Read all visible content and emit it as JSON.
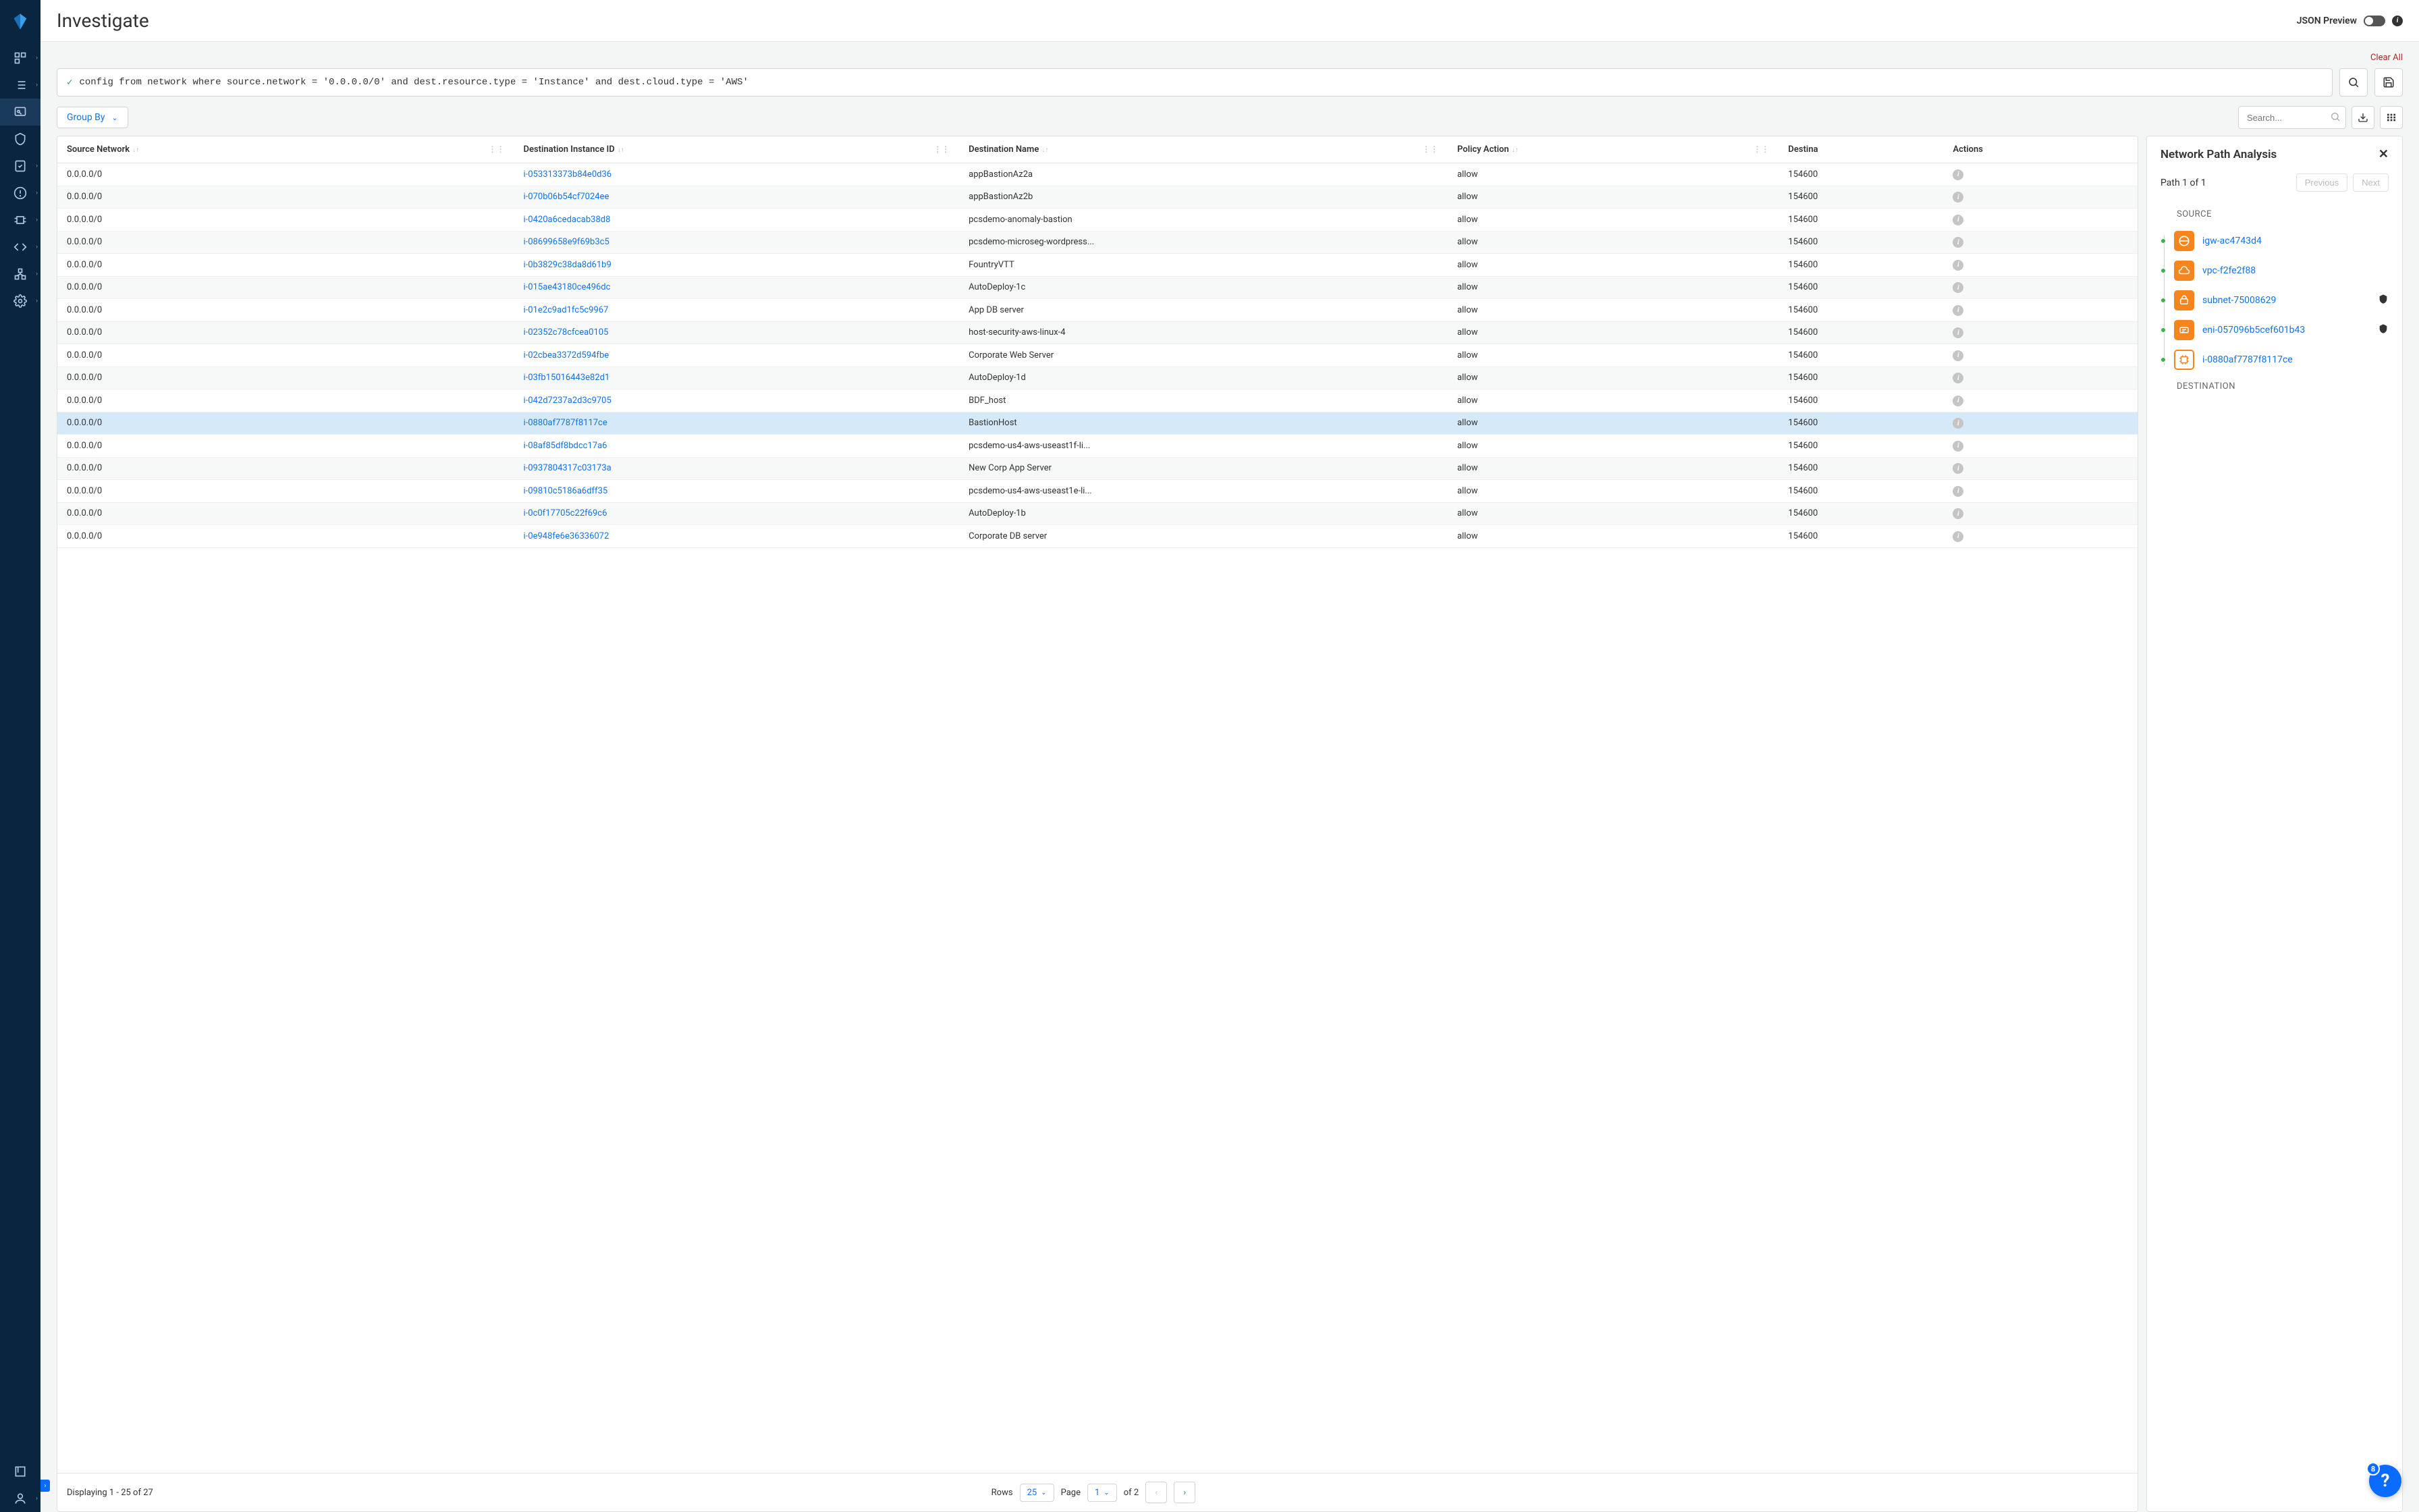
{
  "header": {
    "title": "Investigate",
    "json_preview_label": "JSON Preview"
  },
  "actions": {
    "clear_all": "Clear All"
  },
  "query": {
    "text": "config from network where source.network = '0.0.0.0/0' and dest.resource.type = 'Instance' and dest.cloud.type = 'AWS'"
  },
  "toolbar": {
    "group_by": "Group By",
    "search_placeholder": "Search..."
  },
  "table": {
    "columns": {
      "source_network": "Source Network",
      "dest_instance_id": "Destination Instance ID",
      "dest_name": "Destination Name",
      "policy_action": "Policy Action",
      "dest_trunc": "Destina",
      "actions": "Actions"
    },
    "rows": [
      {
        "src": "0.0.0.0/0",
        "inst": "i-053313373b84e0d36",
        "name": "appBastionAz2a",
        "policy": "allow",
        "dest": "154600"
      },
      {
        "src": "0.0.0.0/0",
        "inst": "i-070b06b54cf7024ee",
        "name": "appBastionAz2b",
        "policy": "allow",
        "dest": "154600"
      },
      {
        "src": "0.0.0.0/0",
        "inst": "i-0420a6cedacab38d8",
        "name": "pcsdemo-anomaly-bastion",
        "policy": "allow",
        "dest": "154600"
      },
      {
        "src": "0.0.0.0/0",
        "inst": "i-08699658e9f69b3c5",
        "name": "pcsdemo-microseg-wordpress...",
        "policy": "allow",
        "dest": "154600"
      },
      {
        "src": "0.0.0.0/0",
        "inst": "i-0b3829c38da8d61b9",
        "name": "FountryVTT",
        "policy": "allow",
        "dest": "154600"
      },
      {
        "src": "0.0.0.0/0",
        "inst": "i-015ae43180ce496dc",
        "name": "AutoDeploy-1c",
        "policy": "allow",
        "dest": "154600"
      },
      {
        "src": "0.0.0.0/0",
        "inst": "i-01e2c9ad1fc5c9967",
        "name": "App DB server",
        "policy": "allow",
        "dest": "154600"
      },
      {
        "src": "0.0.0.0/0",
        "inst": "i-02352c78cfcea0105",
        "name": "host-security-aws-linux-4",
        "policy": "allow",
        "dest": "154600"
      },
      {
        "src": "0.0.0.0/0",
        "inst": "i-02cbea3372d594fbe",
        "name": "Corporate Web Server",
        "policy": "allow",
        "dest": "154600"
      },
      {
        "src": "0.0.0.0/0",
        "inst": "i-03fb15016443e82d1",
        "name": "AutoDeploy-1d",
        "policy": "allow",
        "dest": "154600"
      },
      {
        "src": "0.0.0.0/0",
        "inst": "i-042d7237a2d3c9705",
        "name": "BDF_host",
        "policy": "allow",
        "dest": "154600"
      },
      {
        "src": "0.0.0.0/0",
        "inst": "i-0880af7787f8117ce",
        "name": "BastionHost",
        "policy": "allow",
        "dest": "154600",
        "selected": true
      },
      {
        "src": "0.0.0.0/0",
        "inst": "i-08af85df8bdcc17a6",
        "name": "pcsdemo-us4-aws-useast1f-li...",
        "policy": "allow",
        "dest": "154600"
      },
      {
        "src": "0.0.0.0/0",
        "inst": "i-0937804317c03173a",
        "name": "New Corp App Server",
        "policy": "allow",
        "dest": "154600"
      },
      {
        "src": "0.0.0.0/0",
        "inst": "i-09810c5186a6dff35",
        "name": "pcsdemo-us4-aws-useast1e-li...",
        "policy": "allow",
        "dest": "154600"
      },
      {
        "src": "0.0.0.0/0",
        "inst": "i-0c0f17705c22f69c6",
        "name": "AutoDeploy-1b",
        "policy": "allow",
        "dest": "154600"
      },
      {
        "src": "0.0.0.0/0",
        "inst": "i-0e948fe6e36336072",
        "name": "Corporate DB server",
        "policy": "allow",
        "dest": "154600"
      }
    ]
  },
  "pager": {
    "displaying": "Displaying 1 - 25 of 27",
    "rows_label": "Rows",
    "rows_value": "25",
    "page_label": "Page",
    "page_value": "1",
    "of_label": "of 2"
  },
  "panel": {
    "title": "Network Path Analysis",
    "path_label": "Path 1 of 1",
    "prev": "Previous",
    "next": "Next",
    "source_label": "SOURCE",
    "dest_label": "DESTINATION",
    "items": [
      {
        "label": "igw-ac4743d4",
        "icon": "gateway",
        "style": "solid",
        "shield": false
      },
      {
        "label": "vpc-f2fe2f88",
        "icon": "vpc",
        "style": "solid",
        "shield": false
      },
      {
        "label": "subnet-75008629",
        "icon": "subnet",
        "style": "solid",
        "shield": true
      },
      {
        "label": "eni-057096b5cef601b43",
        "icon": "eni",
        "style": "solid",
        "shield": true
      },
      {
        "label": "i-0880af7787f8117ce",
        "icon": "instance",
        "style": "outline",
        "shield": false
      }
    ]
  },
  "fab": {
    "badge": "8"
  }
}
